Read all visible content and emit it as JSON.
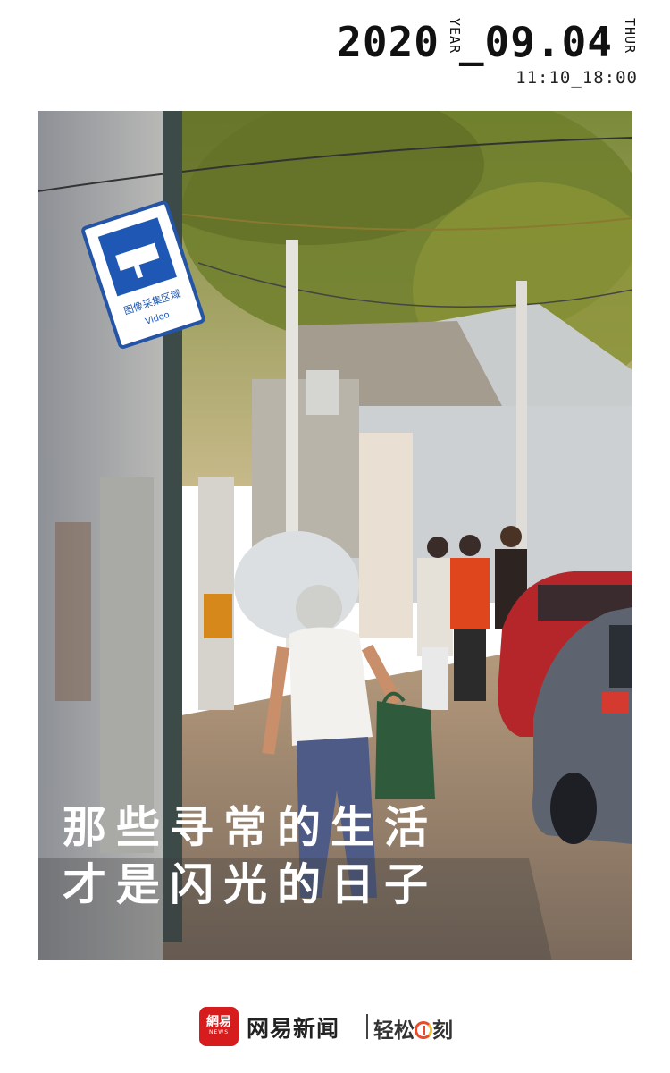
{
  "header": {
    "year": "2020",
    "year_label": "YEAR",
    "month_day": "_09.04",
    "weekday": "THUR",
    "time_range": "11:10_18:00"
  },
  "photo": {
    "sign_text_cn": "图像采集区域",
    "sign_text_en": "Video",
    "subject": "hutong-street-scene"
  },
  "headline": {
    "line1": "那些寻常的生活",
    "line2": "才是闪光的日子"
  },
  "footer": {
    "logo_main": "網易",
    "logo_sub": "NEWS",
    "brand": "网易新闻",
    "column_part1": "轻松",
    "column_part2": "刻"
  },
  "colors": {
    "brand_red": "#d71c1e",
    "background": "#ffffff",
    "headline_text": "#ffffff"
  }
}
